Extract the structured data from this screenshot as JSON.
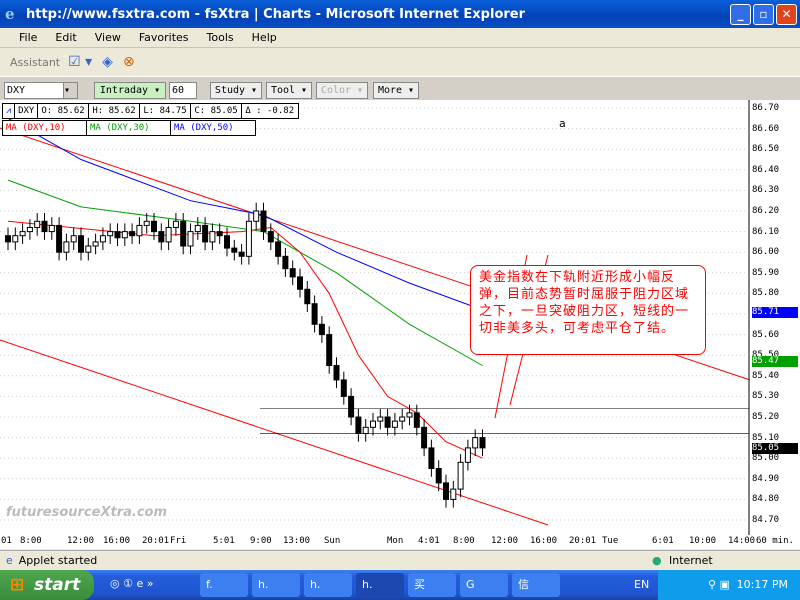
{
  "window": {
    "title": "http://www.fsxtra.com - fsXtra | Charts - Microsoft Internet Explorer"
  },
  "menu": [
    "File",
    "Edit",
    "View",
    "Favorites",
    "Tools",
    "Help"
  ],
  "toolbar": {
    "assistant": "Assistant"
  },
  "app": {
    "symbol": "DXY",
    "period_button": "Intraday ▾",
    "interval": "60",
    "study": "Study ▾",
    "tool": "Tool ▾",
    "color": "Color ▾",
    "more": "More ▾"
  },
  "quote": {
    "symbol": "DXY",
    "open": "O: 85.62",
    "high": "H: 85.62",
    "low": "L: 84.75",
    "close": "C: 85.05",
    "change": "Δ : -0.82"
  },
  "studies": [
    {
      "label": "MA (DXY,10)",
      "color": "#ff0000"
    },
    {
      "label": "MA (DXY,30)",
      "color": "#00a000"
    },
    {
      "label": "MA (DXY,50)",
      "color": "#0000ff"
    }
  ],
  "annotation_a": "a",
  "callout": "美金指数在下轨附近形成小幅反弹，目前态势暂时屈服于阻力区域之下，一旦突破阻力区，短线的一切非美多头，可考虑平仓了结。",
  "watermark": "futuresourceXtra.com",
  "chart_data": {
    "type": "candlestick",
    "symbol": "DXY",
    "interval": "60 min.",
    "ylim": [
      84.7,
      86.7
    ],
    "y_ticks": [
      "86.70",
      "86.60",
      "86.50",
      "86.40",
      "86.30",
      "86.20",
      "86.10",
      "86.00",
      "85.90",
      "85.80",
      "85.70",
      "85.60",
      "85.50",
      "85.40",
      "85.30",
      "85.20",
      "85.10",
      "85.00",
      "84.90",
      "84.80",
      "84.70"
    ],
    "price_labels": [
      {
        "text": "85.71",
        "price": 85.71,
        "color": "#0000ff"
      },
      {
        "text": "85.47",
        "price": 85.47,
        "color": "#00a000"
      },
      {
        "text": "85.05",
        "price": 85.05,
        "color": "#000000"
      }
    ],
    "x_ticks": [
      "01",
      "8:00",
      "12:00",
      "16:00",
      "20:01",
      "Fri",
      "5:01",
      "9:00",
      "13:00",
      "Sun",
      "Mon",
      "4:01",
      "8:00",
      "12:00",
      "16:00",
      "20:01",
      "Tue",
      "6:01",
      "10:00",
      "14:00",
      "60 min."
    ],
    "closes": [
      86.05,
      86.08,
      86.1,
      86.12,
      86.15,
      86.1,
      86.13,
      86.0,
      86.05,
      86.08,
      86.0,
      86.03,
      86.05,
      86.08,
      86.1,
      86.07,
      86.1,
      86.08,
      86.13,
      86.15,
      86.1,
      86.05,
      86.12,
      86.15,
      86.03,
      86.1,
      86.13,
      86.05,
      86.1,
      86.08,
      86.02,
      86.0,
      85.98,
      86.15,
      86.2,
      86.1,
      86.05,
      85.98,
      85.92,
      85.88,
      85.82,
      85.75,
      85.65,
      85.6,
      85.45,
      85.38,
      85.3,
      85.2,
      85.12,
      85.15,
      85.18,
      85.2,
      85.15,
      85.18,
      85.2,
      85.22,
      85.15,
      85.05,
      84.95,
      84.88,
      84.8,
      84.85,
      84.98,
      85.05,
      85.1,
      85.05
    ],
    "ma10": [
      [
        0,
        86.15
      ],
      [
        20,
        86.08
      ],
      [
        32,
        86.1
      ],
      [
        36,
        86.12
      ],
      [
        40,
        86.0
      ],
      [
        44,
        85.8
      ],
      [
        48,
        85.5
      ],
      [
        52,
        85.3
      ],
      [
        56,
        85.22
      ],
      [
        60,
        85.08
      ],
      [
        65,
        85.0
      ]
    ],
    "ma30": [
      [
        0,
        86.35
      ],
      [
        10,
        86.22
      ],
      [
        25,
        86.15
      ],
      [
        35,
        86.1
      ],
      [
        45,
        85.9
      ],
      [
        55,
        85.65
      ],
      [
        65,
        85.45
      ]
    ],
    "ma50": [
      [
        0,
        86.65
      ],
      [
        10,
        86.45
      ],
      [
        25,
        86.25
      ],
      [
        35,
        86.18
      ],
      [
        45,
        86.0
      ],
      [
        55,
        85.85
      ],
      [
        65,
        85.72
      ]
    ],
    "resistance": [
      85.24,
      85.12
    ]
  },
  "status": {
    "text": "Applet started",
    "zone": "Internet"
  },
  "taskbar": {
    "start": "start",
    "tasks": [
      "f.",
      "h.",
      "h.",
      "h.",
      "买",
      "G",
      "信"
    ],
    "lang": "EN",
    "clock": "10:17 PM"
  }
}
